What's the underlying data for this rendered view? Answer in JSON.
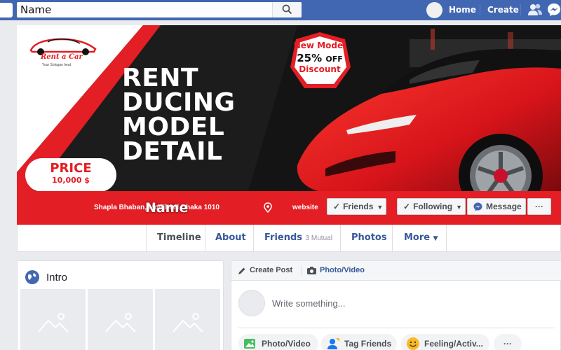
{
  "topbar": {
    "search_value": "Name",
    "home_label": "Home",
    "create_label": "Create",
    "icons": [
      "search-icon",
      "friends-icon",
      "messenger-icon"
    ],
    "color": "#4267b2"
  },
  "cover": {
    "brand_name": "Rent a Car",
    "brand_slogan": "Your Sologan heat",
    "headline": [
      "RENT",
      "DUCING",
      "MODEL",
      "DETAIL"
    ],
    "promo": {
      "top": "New Model",
      "percent": "25%",
      "off": "OFF",
      "bottom": "Discount"
    },
    "price_label": "PRICE",
    "price_value": "10,000 $",
    "address": "Shapla Bhaban, Motijheel Dhaka 1010",
    "website": "website",
    "page_name": "Name",
    "accent_color": "#e31e24"
  },
  "cover_buttons": {
    "friends": "Friends",
    "following": "Following",
    "message": "Message",
    "more": "···"
  },
  "tabs": [
    {
      "label": "Timeline",
      "active": true
    },
    {
      "label": "About"
    },
    {
      "label": "Friends",
      "sub": "3 Mutual"
    },
    {
      "label": "Photos"
    },
    {
      "label": "More"
    }
  ],
  "intro": {
    "title": "Intro"
  },
  "composer": {
    "create_post": "Create Post",
    "photo_video_tab": "Photo/Video",
    "placeholder": "Write something...",
    "actions": [
      "Photo/Video",
      "Tag Friends",
      "Feeling/Activ..."
    ],
    "more": "···"
  }
}
